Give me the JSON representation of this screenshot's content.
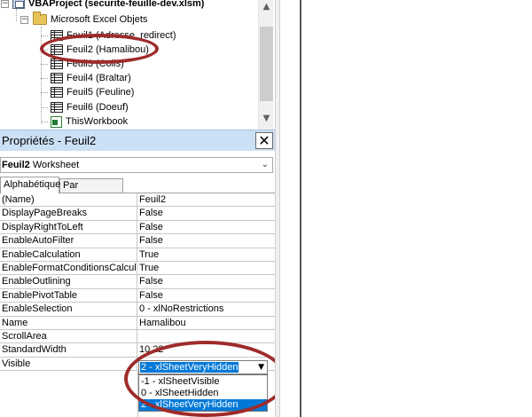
{
  "project_tree": {
    "project_label": "VBAProject (securite-feuille-dev.xlsm)",
    "folder_label": "Microsoft Excel Objets",
    "items": [
      {
        "label": "Feuil1 (Adresse_redirect)",
        "icon": "sheet-icon"
      },
      {
        "label": "Feuil2 (Hamalibou)",
        "icon": "sheet-icon"
      },
      {
        "label": "Feuil3 (Colis)",
        "icon": "sheet-icon"
      },
      {
        "label": "Feuil4 (Braltar)",
        "icon": "sheet-icon"
      },
      {
        "label": "Feuil5 (Feuline)",
        "icon": "sheet-icon"
      },
      {
        "label": "Feuil6 (Doeuf)",
        "icon": "sheet-icon"
      },
      {
        "label": "ThisWorkbook",
        "icon": "workbook-icon"
      }
    ]
  },
  "properties": {
    "title": "Propriétés - Feuil2",
    "close_symbol": "✕",
    "object_name": "Feuil2",
    "object_type": "Worksheet",
    "tabs": [
      "Alphabétique",
      "Par catégorie"
    ],
    "rows": [
      {
        "name": "(Name)",
        "value": "Feuil2"
      },
      {
        "name": "DisplayPageBreaks",
        "value": "False"
      },
      {
        "name": "DisplayRightToLeft",
        "value": "False"
      },
      {
        "name": "EnableAutoFilter",
        "value": "False"
      },
      {
        "name": "EnableCalculation",
        "value": "True"
      },
      {
        "name": "EnableFormatConditionsCalculation",
        "value": "True"
      },
      {
        "name": "EnableOutlining",
        "value": "False"
      },
      {
        "name": "EnablePivotTable",
        "value": "False"
      },
      {
        "name": "EnableSelection",
        "value": "0 - xlNoRestrictions"
      },
      {
        "name": "Name",
        "value": "Hamalibou"
      },
      {
        "name": "ScrollArea",
        "value": ""
      },
      {
        "name": "StandardWidth",
        "value": "10,22"
      },
      {
        "name": "Visible",
        "value": ""
      }
    ],
    "visible_dropdown": {
      "selected": "2 - xlSheetVeryHidden",
      "options": [
        "-1 - xlSheetVisible",
        "0 - xlSheetHidden",
        "2 - xlSheetVeryHidden"
      ],
      "highlighted_option": "2 - xlSheetVeryHidden"
    }
  },
  "colors": {
    "title_bar": "#cce0f5",
    "selection": "#0078d7",
    "annotation": "#9e2b2b"
  }
}
